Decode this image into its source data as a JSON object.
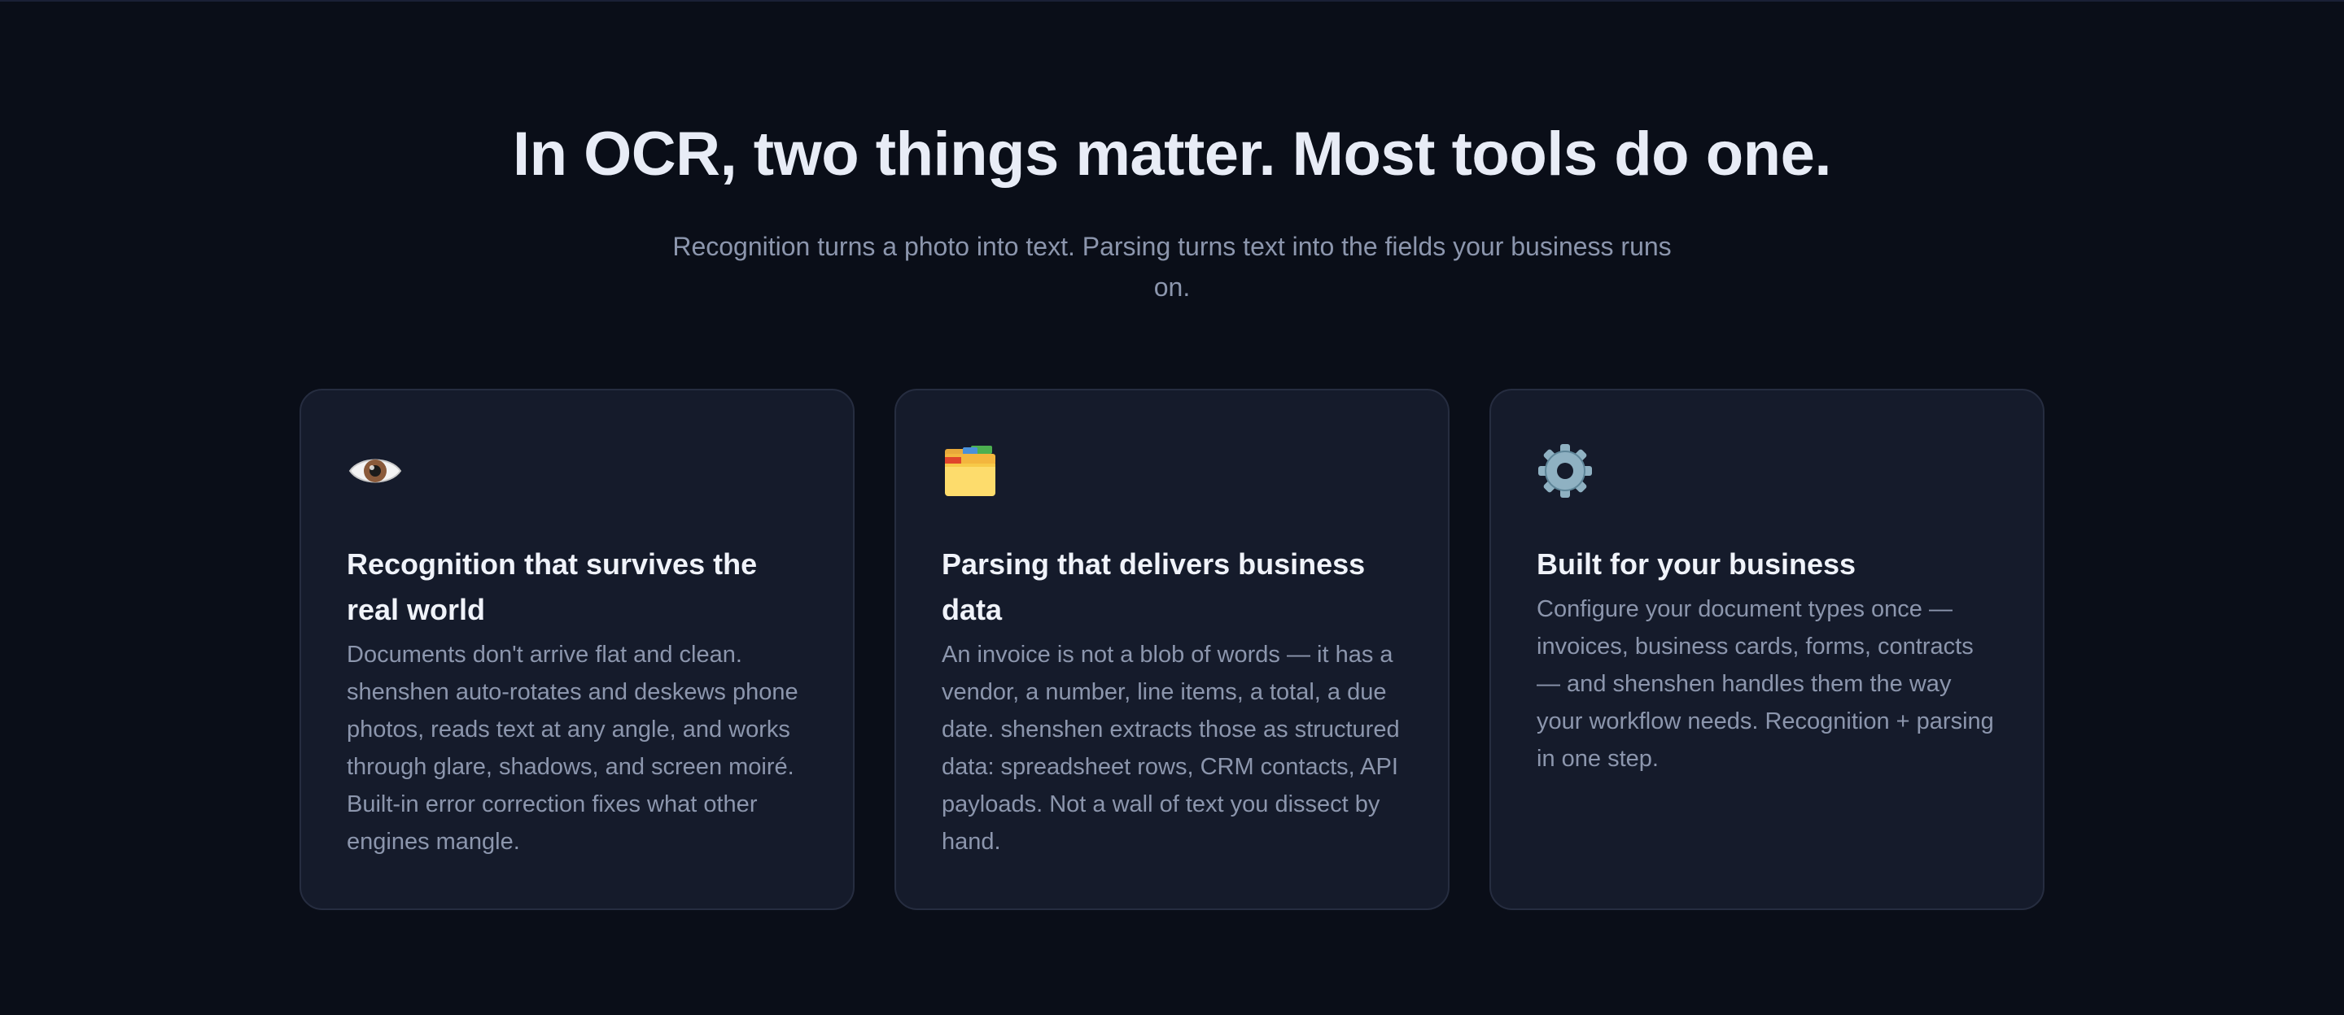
{
  "hero": {
    "title": "In OCR, two things matter. Most tools do one.",
    "subtitle": "Recognition turns a photo into text. Parsing turns text into the fields your business runs on."
  },
  "cards": [
    {
      "icon": "eye-icon",
      "title": "Recognition that survives the real world",
      "body": "Documents don't arrive flat and clean. shenshen auto-rotates and deskews phone photos, reads text at any angle, and works through glare, shadows, and screen moiré. Built-in error correction fixes what other engines mangle."
    },
    {
      "icon": "folder-icon",
      "title": "Parsing that delivers business data",
      "body": "An invoice is not a blob of words — it has a vendor, a number, line items, a total, a due date. shenshen extracts those as structured data: spreadsheet rows, CRM contacts, API payloads. Not a wall of text you dissect by hand."
    },
    {
      "icon": "gear-icon",
      "title": "Built for your business",
      "body": "Configure your document types once — invoices, business cards, forms, contracts — and shenshen handles them the way your workflow needs. Recognition + parsing in one step."
    }
  ],
  "colors": {
    "background": "#0a0e18",
    "card": "#151b2b",
    "card_border": "#262d40",
    "title": "#e8ecf6",
    "muted": "#8c96ad"
  }
}
